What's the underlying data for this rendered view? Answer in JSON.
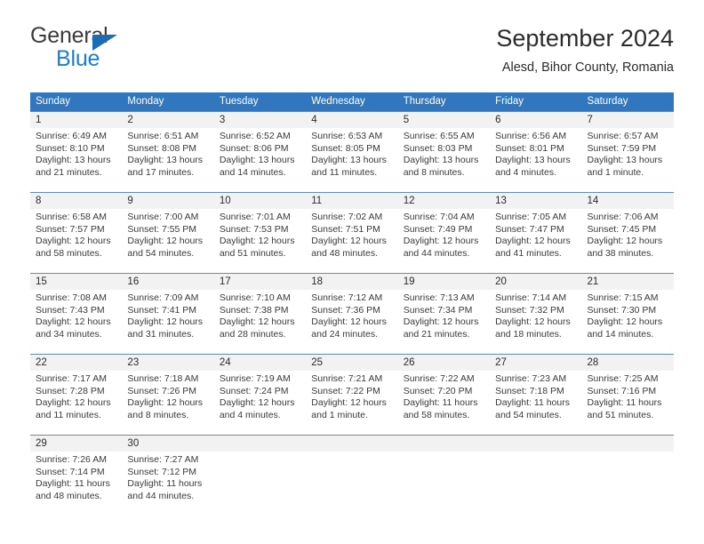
{
  "brand": {
    "name_top": "General",
    "name_bottom": "Blue",
    "triangle_color": "#1a6cb5",
    "top_color": "#3b3b3b",
    "bottom_color": "#1a7ed1"
  },
  "header": {
    "title": "September 2024",
    "subtitle": "Alesd, Bihor County, Romania"
  },
  "theme": {
    "header_bg": "#3276bd",
    "header_text": "#ffffff",
    "daynum_bg": "#f2f2f2",
    "row_rule": "#5b8fc4",
    "body_text": "#3a3a3a"
  },
  "weekday_headers": [
    "Sunday",
    "Monday",
    "Tuesday",
    "Wednesday",
    "Thursday",
    "Friday",
    "Saturday"
  ],
  "weeks": [
    {
      "numbers": [
        "1",
        "2",
        "3",
        "4",
        "5",
        "6",
        "7"
      ],
      "days": [
        {
          "sunrise": "Sunrise: 6:49 AM",
          "sunset": "Sunset: 8:10 PM",
          "daylight_1": "Daylight: 13 hours",
          "daylight_2": "and 21 minutes."
        },
        {
          "sunrise": "Sunrise: 6:51 AM",
          "sunset": "Sunset: 8:08 PM",
          "daylight_1": "Daylight: 13 hours",
          "daylight_2": "and 17 minutes."
        },
        {
          "sunrise": "Sunrise: 6:52 AM",
          "sunset": "Sunset: 8:06 PM",
          "daylight_1": "Daylight: 13 hours",
          "daylight_2": "and 14 minutes."
        },
        {
          "sunrise": "Sunrise: 6:53 AM",
          "sunset": "Sunset: 8:05 PM",
          "daylight_1": "Daylight: 13 hours",
          "daylight_2": "and 11 minutes."
        },
        {
          "sunrise": "Sunrise: 6:55 AM",
          "sunset": "Sunset: 8:03 PM",
          "daylight_1": "Daylight: 13 hours",
          "daylight_2": "and 8 minutes."
        },
        {
          "sunrise": "Sunrise: 6:56 AM",
          "sunset": "Sunset: 8:01 PM",
          "daylight_1": "Daylight: 13 hours",
          "daylight_2": "and 4 minutes."
        },
        {
          "sunrise": "Sunrise: 6:57 AM",
          "sunset": "Sunset: 7:59 PM",
          "daylight_1": "Daylight: 13 hours",
          "daylight_2": "and 1 minute."
        }
      ]
    },
    {
      "numbers": [
        "8",
        "9",
        "10",
        "11",
        "12",
        "13",
        "14"
      ],
      "days": [
        {
          "sunrise": "Sunrise: 6:58 AM",
          "sunset": "Sunset: 7:57 PM",
          "daylight_1": "Daylight: 12 hours",
          "daylight_2": "and 58 minutes."
        },
        {
          "sunrise": "Sunrise: 7:00 AM",
          "sunset": "Sunset: 7:55 PM",
          "daylight_1": "Daylight: 12 hours",
          "daylight_2": "and 54 minutes."
        },
        {
          "sunrise": "Sunrise: 7:01 AM",
          "sunset": "Sunset: 7:53 PM",
          "daylight_1": "Daylight: 12 hours",
          "daylight_2": "and 51 minutes."
        },
        {
          "sunrise": "Sunrise: 7:02 AM",
          "sunset": "Sunset: 7:51 PM",
          "daylight_1": "Daylight: 12 hours",
          "daylight_2": "and 48 minutes."
        },
        {
          "sunrise": "Sunrise: 7:04 AM",
          "sunset": "Sunset: 7:49 PM",
          "daylight_1": "Daylight: 12 hours",
          "daylight_2": "and 44 minutes."
        },
        {
          "sunrise": "Sunrise: 7:05 AM",
          "sunset": "Sunset: 7:47 PM",
          "daylight_1": "Daylight: 12 hours",
          "daylight_2": "and 41 minutes."
        },
        {
          "sunrise": "Sunrise: 7:06 AM",
          "sunset": "Sunset: 7:45 PM",
          "daylight_1": "Daylight: 12 hours",
          "daylight_2": "and 38 minutes."
        }
      ]
    },
    {
      "numbers": [
        "15",
        "16",
        "17",
        "18",
        "19",
        "20",
        "21"
      ],
      "days": [
        {
          "sunrise": "Sunrise: 7:08 AM",
          "sunset": "Sunset: 7:43 PM",
          "daylight_1": "Daylight: 12 hours",
          "daylight_2": "and 34 minutes."
        },
        {
          "sunrise": "Sunrise: 7:09 AM",
          "sunset": "Sunset: 7:41 PM",
          "daylight_1": "Daylight: 12 hours",
          "daylight_2": "and 31 minutes."
        },
        {
          "sunrise": "Sunrise: 7:10 AM",
          "sunset": "Sunset: 7:38 PM",
          "daylight_1": "Daylight: 12 hours",
          "daylight_2": "and 28 minutes."
        },
        {
          "sunrise": "Sunrise: 7:12 AM",
          "sunset": "Sunset: 7:36 PM",
          "daylight_1": "Daylight: 12 hours",
          "daylight_2": "and 24 minutes."
        },
        {
          "sunrise": "Sunrise: 7:13 AM",
          "sunset": "Sunset: 7:34 PM",
          "daylight_1": "Daylight: 12 hours",
          "daylight_2": "and 21 minutes."
        },
        {
          "sunrise": "Sunrise: 7:14 AM",
          "sunset": "Sunset: 7:32 PM",
          "daylight_1": "Daylight: 12 hours",
          "daylight_2": "and 18 minutes."
        },
        {
          "sunrise": "Sunrise: 7:15 AM",
          "sunset": "Sunset: 7:30 PM",
          "daylight_1": "Daylight: 12 hours",
          "daylight_2": "and 14 minutes."
        }
      ]
    },
    {
      "numbers": [
        "22",
        "23",
        "24",
        "25",
        "26",
        "27",
        "28"
      ],
      "days": [
        {
          "sunrise": "Sunrise: 7:17 AM",
          "sunset": "Sunset: 7:28 PM",
          "daylight_1": "Daylight: 12 hours",
          "daylight_2": "and 11 minutes."
        },
        {
          "sunrise": "Sunrise: 7:18 AM",
          "sunset": "Sunset: 7:26 PM",
          "daylight_1": "Daylight: 12 hours",
          "daylight_2": "and 8 minutes."
        },
        {
          "sunrise": "Sunrise: 7:19 AM",
          "sunset": "Sunset: 7:24 PM",
          "daylight_1": "Daylight: 12 hours",
          "daylight_2": "and 4 minutes."
        },
        {
          "sunrise": "Sunrise: 7:21 AM",
          "sunset": "Sunset: 7:22 PM",
          "daylight_1": "Daylight: 12 hours",
          "daylight_2": "and 1 minute."
        },
        {
          "sunrise": "Sunrise: 7:22 AM",
          "sunset": "Sunset: 7:20 PM",
          "daylight_1": "Daylight: 11 hours",
          "daylight_2": "and 58 minutes."
        },
        {
          "sunrise": "Sunrise: 7:23 AM",
          "sunset": "Sunset: 7:18 PM",
          "daylight_1": "Daylight: 11 hours",
          "daylight_2": "and 54 minutes."
        },
        {
          "sunrise": "Sunrise: 7:25 AM",
          "sunset": "Sunset: 7:16 PM",
          "daylight_1": "Daylight: 11 hours",
          "daylight_2": "and 51 minutes."
        }
      ]
    },
    {
      "numbers": [
        "29",
        "30",
        "",
        "",
        "",
        "",
        ""
      ],
      "days": [
        {
          "sunrise": "Sunrise: 7:26 AM",
          "sunset": "Sunset: 7:14 PM",
          "daylight_1": "Daylight: 11 hours",
          "daylight_2": "and 48 minutes."
        },
        {
          "sunrise": "Sunrise: 7:27 AM",
          "sunset": "Sunset: 7:12 PM",
          "daylight_1": "Daylight: 11 hours",
          "daylight_2": "and 44 minutes."
        },
        {
          "sunrise": "",
          "sunset": "",
          "daylight_1": "",
          "daylight_2": ""
        },
        {
          "sunrise": "",
          "sunset": "",
          "daylight_1": "",
          "daylight_2": ""
        },
        {
          "sunrise": "",
          "sunset": "",
          "daylight_1": "",
          "daylight_2": ""
        },
        {
          "sunrise": "",
          "sunset": "",
          "daylight_1": "",
          "daylight_2": ""
        },
        {
          "sunrise": "",
          "sunset": "",
          "daylight_1": "",
          "daylight_2": ""
        }
      ]
    }
  ]
}
